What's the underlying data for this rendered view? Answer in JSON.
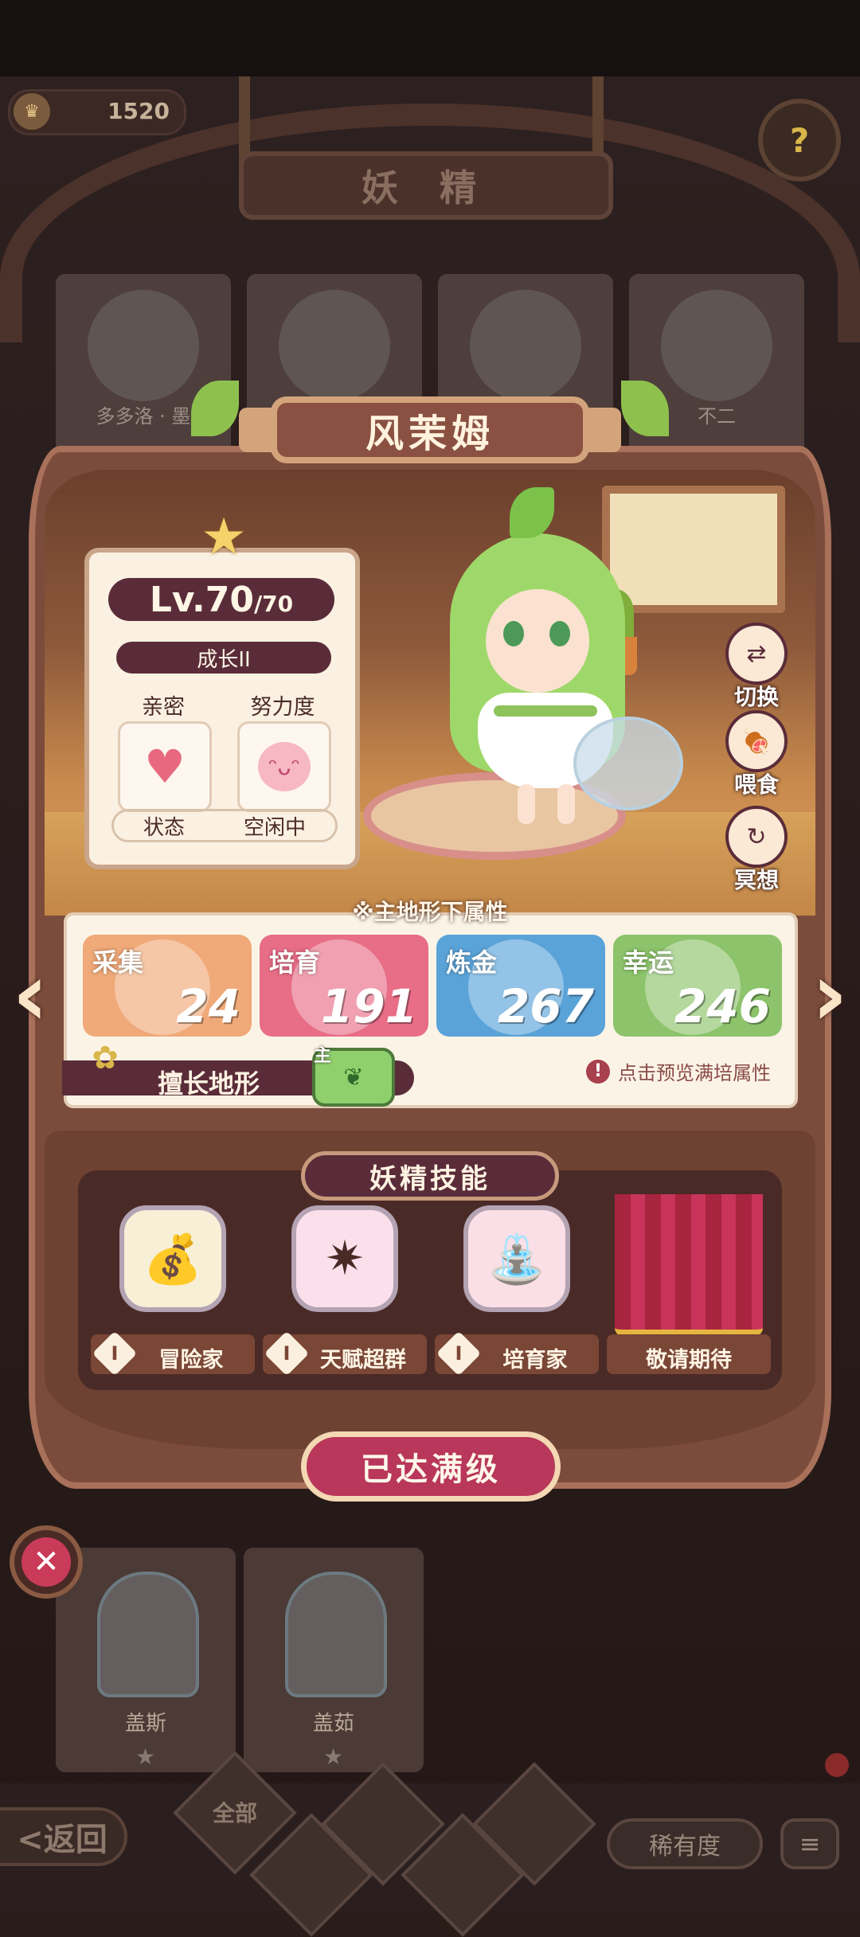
{
  "header": {
    "title": "妖 精",
    "coins": "1520",
    "coin_icon": "crown-coin-icon",
    "help_icon": "help-flower-icon"
  },
  "background_cards": [
    {
      "name": "多多洛 · 墨"
    },
    {
      "name": ""
    },
    {
      "name": ""
    },
    {
      "name": "不二"
    }
  ],
  "fairy": {
    "name": "风茉姆",
    "level": "Lv.70",
    "level_max": "/70",
    "growth": "成长II",
    "intimacy_label": "亲密",
    "effort_label": "努力度",
    "status_label": "状态",
    "status_value": "空闲中"
  },
  "side_actions": [
    {
      "label": "切换",
      "icon": "switch-icon"
    },
    {
      "label": "喂食",
      "icon": "meat-icon"
    },
    {
      "label": "冥想",
      "icon": "meditate-icon"
    }
  ],
  "attributes": {
    "heading": "※主地形下属性",
    "items": [
      {
        "label": "采集",
        "value": "24",
        "color": "#f0a978"
      },
      {
        "label": "培育",
        "value": "191",
        "color": "#e86d86"
      },
      {
        "label": "炼金",
        "value": "267",
        "color": "#5aa3d9"
      },
      {
        "label": "幸运",
        "value": "246",
        "color": "#8cc36b"
      }
    ],
    "terrain_label": "擅长地形",
    "terrain_main": "主",
    "preview_text": "点击预览满培属性"
  },
  "skills": {
    "title": "妖精技能",
    "items": [
      {
        "name": "冒险家",
        "icon": "adventure-bag-icon"
      },
      {
        "name": "天赋超群",
        "icon": "talent-star-icon"
      },
      {
        "name": "培育家",
        "icon": "watering-can-icon"
      },
      {
        "name": "敬请期待",
        "icon": "curtain-icon"
      }
    ],
    "info_glyph": "I"
  },
  "maxed_button": "已达满级",
  "lower_cards": [
    {
      "name": "盖斯"
    },
    {
      "name": "盖茹"
    }
  ],
  "bottom_nav": {
    "back": "<返回",
    "all": "全部",
    "rarity": "稀有度",
    "list_icon": "list-icon"
  }
}
